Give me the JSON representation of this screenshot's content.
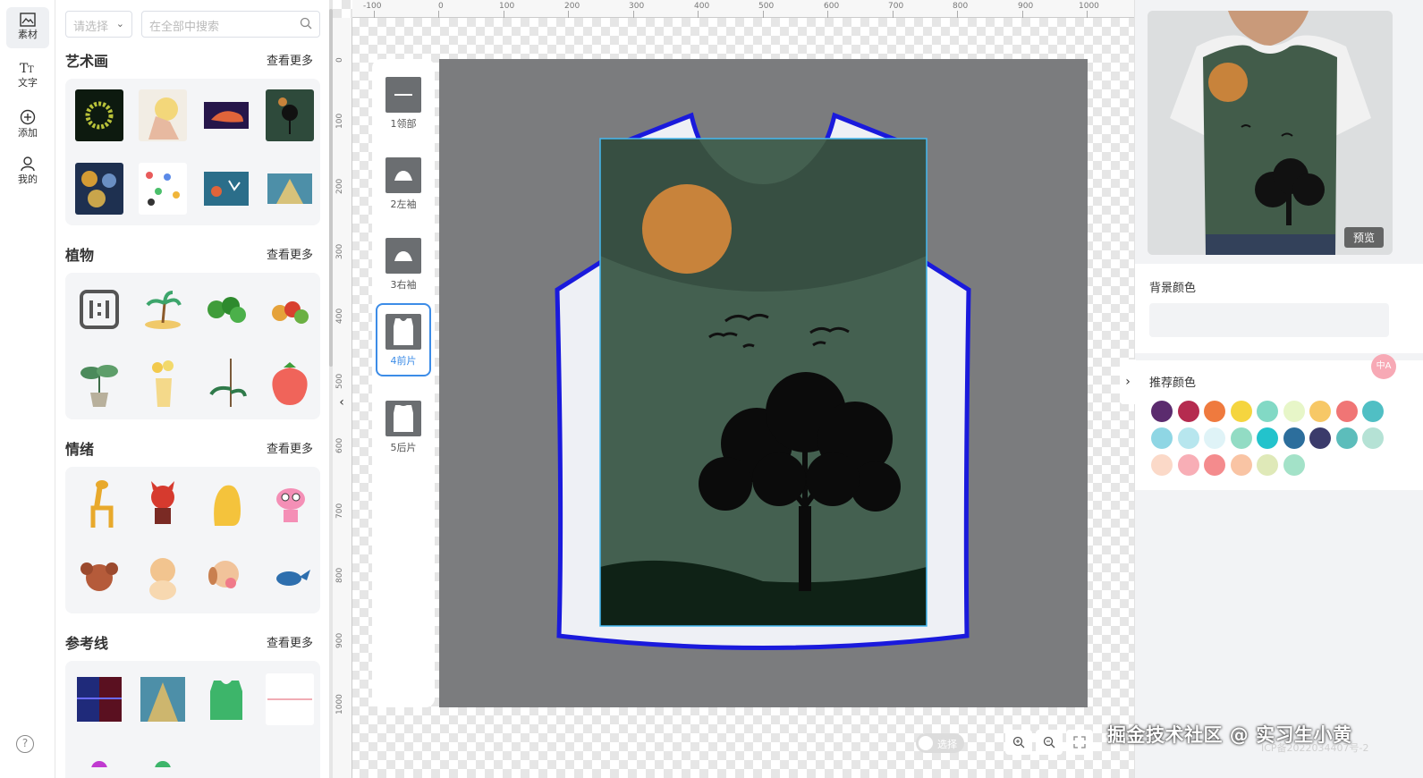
{
  "rail": {
    "items": [
      {
        "label": "素材",
        "icon": "image-icon"
      },
      {
        "label": "文字",
        "icon": "text-icon"
      },
      {
        "label": "添加",
        "icon": "plus-circle-icon"
      },
      {
        "label": "我的",
        "icon": "user-icon"
      }
    ],
    "help": "?"
  },
  "assets": {
    "select_placeholder": "请选择",
    "search_placeholder": "在全部中搜索",
    "sections": [
      {
        "title": "艺术画",
        "more": "查看更多"
      },
      {
        "title": "植物",
        "more": "查看更多"
      },
      {
        "title": "情绪",
        "more": "查看更多"
      },
      {
        "title": "参考线",
        "more": "查看更多"
      }
    ]
  },
  "ruler": {
    "h_labels": [
      "-100",
      "0",
      "100",
      "200",
      "300",
      "400",
      "500",
      "600",
      "700",
      "800",
      "900",
      "1000"
    ],
    "v_labels": [
      "0",
      "100",
      "200",
      "300",
      "400",
      "500",
      "600",
      "700",
      "800",
      "900",
      "1000"
    ]
  },
  "pieces": [
    {
      "label": "1领部"
    },
    {
      "label": "2左袖"
    },
    {
      "label": "3右袖"
    },
    {
      "label": "4前片"
    },
    {
      "label": "5后片"
    }
  ],
  "toolbar": {
    "select_toggle": "选择"
  },
  "right": {
    "preview_button": "预览",
    "bg_color_label": "背景颜色",
    "rec_color_label": "推荐颜色",
    "swatches": [
      "#5b2b6e",
      "#b52b4f",
      "#ef7a3e",
      "#f5d53f",
      "#82d9c5",
      "#e7f6c8",
      "#f7c866",
      "#f07575",
      "#50bfc4",
      "#8fd6e4",
      "#b7e6ee",
      "#dff3f7",
      "#92dcc4",
      "#23c3cc",
      "#2c6e9c",
      "#3b3b6b",
      "#5cbdbb",
      "#b5e2d5",
      "#fbd9c8",
      "#f8aeb6",
      "#f48b8d",
      "#f9c4a4",
      "#dfe9b8",
      "#a3e2c8"
    ],
    "fab": "中A"
  },
  "watermark": "掘金技术社区 @ 实习生小黄",
  "icp": "ICP备2022034407号-2"
}
